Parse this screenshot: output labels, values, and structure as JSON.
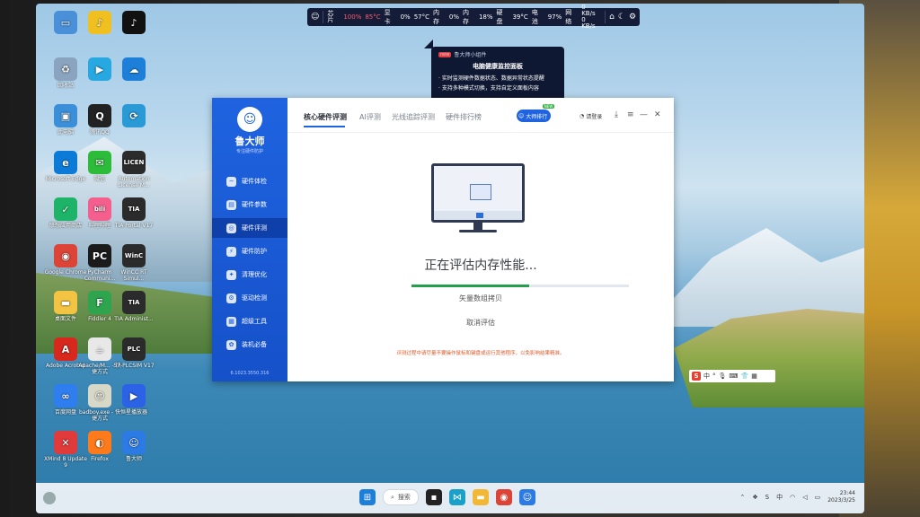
{
  "topbar": {
    "cpu_label": "芯片",
    "cpu_usage": "100%",
    "cpu_temp": "85°C",
    "disk_label": "显卡",
    "disk_usage": "0%",
    "disk_temp": "57°C",
    "mem_label": "内存",
    "mem_usage": "0%",
    "vram_label": "内存",
    "vram_usage": "18%",
    "hdd_label": "硬盘",
    "hdd_temp": "39°C",
    "bat_label": "电池",
    "bat_usage": "97%",
    "net_label": "网络",
    "net_up": "0 KB/s",
    "net_down": "0 KB/s"
  },
  "tip": {
    "brand": "鲁大师小组件",
    "badge": "new",
    "title": "电脑健康监控面板",
    "line1": "· 实时监测硬件数据状态、数据异常状态提醒",
    "line2": "· 支持多种模式切换，支持自定义面板内容"
  },
  "desktop_icons": [
    {
      "name": "desktop-icon-blank",
      "label": "",
      "glyph": "▭",
      "color": "#4a90d9"
    },
    {
      "name": "desktop-icon-1",
      "label": "",
      "glyph": "♪",
      "color": "#f0c020"
    },
    {
      "name": "desktop-icon-tiktok",
      "label": "",
      "glyph": "♪",
      "color": "#111111"
    },
    {
      "name": "desktop-icon-recycle",
      "label": "回收站",
      "glyph": "♻",
      "color": "#8aa4c0"
    },
    {
      "name": "desktop-icon-player",
      "label": "",
      "glyph": "▶",
      "color": "#27a8e0"
    },
    {
      "name": "desktop-icon-cloud",
      "label": "",
      "glyph": "☁",
      "color": "#1e7fd8"
    },
    {
      "name": "desktop-icon-pc",
      "label": "此电脑",
      "glyph": "▣",
      "color": "#3b8fd9"
    },
    {
      "name": "desktop-icon-qq",
      "label": "腾讯QQ",
      "glyph": "Q",
      "color": "#222222"
    },
    {
      "name": "desktop-icon-2",
      "label": "",
      "glyph": "⟳",
      "color": "#2a9ad6"
    },
    {
      "name": "desktop-icon-edge",
      "label": "Microsoft Edge",
      "glyph": "e",
      "color": "#0c7bd8"
    },
    {
      "name": "desktop-icon-wechat",
      "label": "微信",
      "glyph": "✉",
      "color": "#2dbb3a"
    },
    {
      "name": "desktop-icon-license",
      "label": "Automation License M...",
      "glyph": "LICEN",
      "color": "#2b2b2b"
    },
    {
      "name": "desktop-icon-store",
      "label": "联想应用商店",
      "glyph": "✓",
      "color": "#1db368"
    },
    {
      "name": "desktop-icon-bili",
      "label": "哔哩哔哩",
      "glyph": "bili",
      "color": "#f55f8e"
    },
    {
      "name": "desktop-icon-tia",
      "label": "TIA Portal V17",
      "glyph": "TIA",
      "color": "#2b2b2b"
    },
    {
      "name": "desktop-icon-chrome",
      "label": "Google Chrome",
      "glyph": "◉",
      "color": "#db4437"
    },
    {
      "name": "desktop-icon-pycharm",
      "label": "PyCharm Communi...",
      "glyph": "PC",
      "color": "#1b1b1b"
    },
    {
      "name": "desktop-icon-wincc",
      "label": "WinCC RT Simul...",
      "glyph": "WinC",
      "color": "#2b2b2b"
    },
    {
      "name": "desktop-icon-folder",
      "label": "桌面文件",
      "glyph": "▬",
      "color": "#f3c343"
    },
    {
      "name": "desktop-icon-fiddler",
      "label": "Fiddler 4",
      "glyph": "F",
      "color": "#2ea44f"
    },
    {
      "name": "desktop-icon-tiaadmin",
      "label": "TIA Administ...",
      "glyph": "TIA",
      "color": "#2b2b2b"
    },
    {
      "name": "desktop-icon-acrobat",
      "label": "Adobe Acrobat",
      "glyph": "A",
      "color": "#d8281d"
    },
    {
      "name": "desktop-icon-apache",
      "label": "Apache/M... - 快捷方式",
      "glyph": "☕",
      "color": "#e8e8e8"
    },
    {
      "name": "desktop-icon-plcsim",
      "label": "S7-PLCSIM V17",
      "glyph": "PLC",
      "color": "#2b2b2b"
    },
    {
      "name": "desktop-icon-baidu",
      "label": "百度网盘",
      "glyph": "∞",
      "color": "#2f7ef0"
    },
    {
      "name": "desktop-icon-badboy",
      "label": "badboy.exe - 快捷方式",
      "glyph": "☺",
      "color": "#d8d8c8"
    },
    {
      "name": "desktop-icon-video",
      "label": "恒星播放器",
      "glyph": "▶",
      "color": "#2c63e6"
    },
    {
      "name": "desktop-icon-xmind",
      "label": "XMind 8 Update 9",
      "glyph": "✕",
      "color": "#e03a3a"
    },
    {
      "name": "desktop-icon-firefox",
      "label": "Firefox",
      "glyph": "◐",
      "color": "#ff7a1a"
    },
    {
      "name": "desktop-icon-ludashi",
      "label": "鲁大师",
      "glyph": "☺",
      "color": "#2c7be5"
    }
  ],
  "app": {
    "brand": "鲁大师",
    "slogan": "专注硬件防护",
    "version": "6.1023.3550.316",
    "nav": [
      {
        "label": "硬件体检",
        "icon": "~"
      },
      {
        "label": "硬件参数",
        "icon": "▤"
      },
      {
        "label": "硬件评测",
        "icon": "◎"
      },
      {
        "label": "硬件防护",
        "icon": "⚡"
      },
      {
        "label": "清理优化",
        "icon": "✦"
      },
      {
        "label": "驱动检测",
        "icon": "⚙"
      },
      {
        "label": "超级工具",
        "icon": "▦"
      },
      {
        "label": "装机必备",
        "icon": "✿"
      }
    ],
    "tabs": [
      "核心硬件评测",
      "AI评测",
      "光线追踪评测",
      "硬件排行榜"
    ],
    "dashi_label": "大师排行",
    "new_badge": "NEW",
    "login_label": "请登录",
    "status_text": "正在评估内存性能...",
    "progress": 0.54,
    "subtask": "矢量数组拷贝",
    "cancel_label": "取消评估",
    "warning": "评测过程中请尽量不要操作鼠标和键盘或运行其他程序，以免影响结果精准。"
  },
  "ime": {
    "mode": "中"
  },
  "taskbar": {
    "search_label": "搜索",
    "time": "23:44",
    "date": "2023/3/25"
  }
}
